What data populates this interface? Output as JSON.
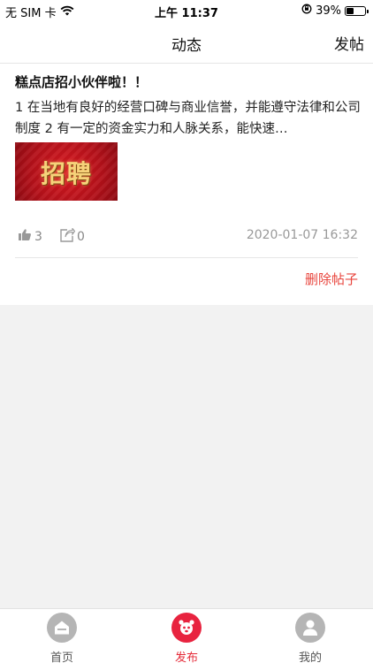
{
  "status_bar": {
    "carrier": "无 SIM 卡",
    "time": "上午 11:37",
    "battery": "39%",
    "battery_level": 0.39
  },
  "nav": {
    "title": "动态",
    "action": "发帖"
  },
  "post": {
    "title": "糕点店招小伙伴啦！！",
    "body": "1 在当地有良好的经营口碑与商业信誉，并能遵守法律和公司制度 2 有一定的资金实力和人脉关系，能快速…",
    "image_text": "招聘",
    "likes": "3",
    "shares": "0",
    "time": "2020-01-07 16:32",
    "delete_label": "删除帖子"
  },
  "tabs": [
    {
      "label": "首页",
      "icon": "home-icon",
      "color": "#b5b5b5"
    },
    {
      "label": "发布",
      "icon": "publish-icon",
      "color": "#e8233f"
    },
    {
      "label": "我的",
      "icon": "profile-icon",
      "color": "#b5b5b5"
    }
  ]
}
